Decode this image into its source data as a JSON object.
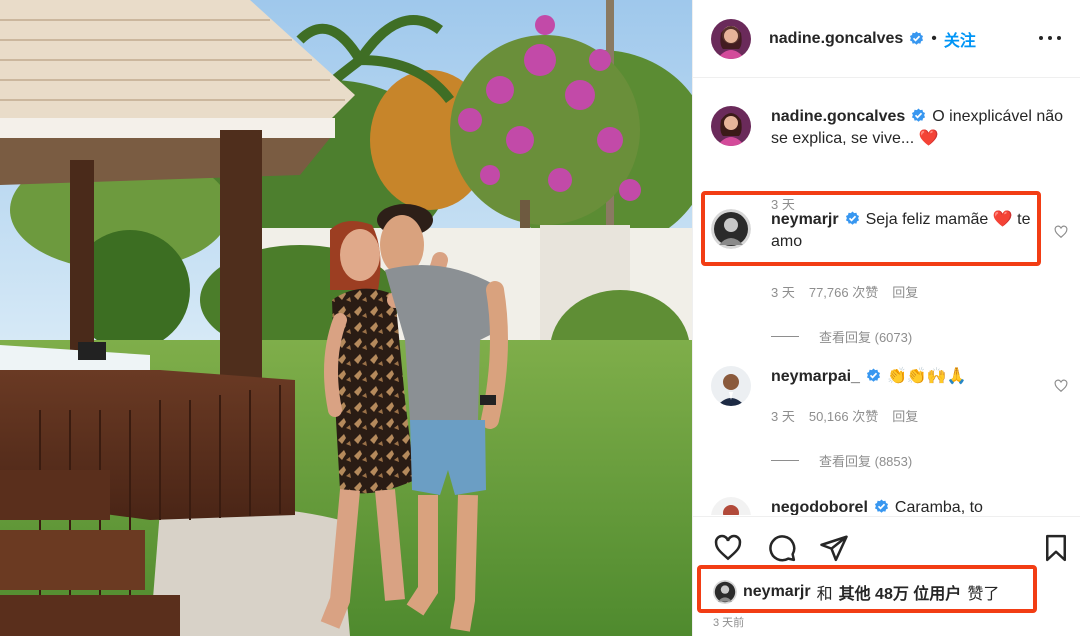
{
  "post": {
    "author": "nadine.goncalves",
    "follow_label": "关注",
    "dot": "•"
  },
  "comments": [
    {
      "username": "nadine.goncalves",
      "text": "O inexplicável não se explica, se vive... ❤️",
      "time": "3 天"
    },
    {
      "username": "neymarjr",
      "text": "Seja feliz mamãe ❤️ te amo",
      "time": "3 天",
      "likes": "77,766 次赞",
      "reply_label": "回复",
      "view_replies": "查看回复 (6073)"
    },
    {
      "username": "neymarpai_",
      "text": "👏👏🙌🙏",
      "time": "3 天",
      "likes": "50,166 次赞",
      "reply_label": "回复",
      "view_replies": "查看回复 (8853)"
    },
    {
      "username": "negodoborel",
      "text": "Caramba, to"
    }
  ],
  "likes_summary": {
    "user": "neymarjr",
    "conj": "和",
    "others": "其他 48万 位用户",
    "suffix": "赞了"
  },
  "post_time": "3 天前",
  "icons": [
    "heart-icon",
    "comment-icon",
    "share-icon",
    "bookmark-icon",
    "more-icon",
    "verified-icon"
  ],
  "colors": {
    "accent": "#0095f6",
    "highlight": "#f23d14",
    "text": "#262626",
    "muted": "#8e8e8e"
  }
}
